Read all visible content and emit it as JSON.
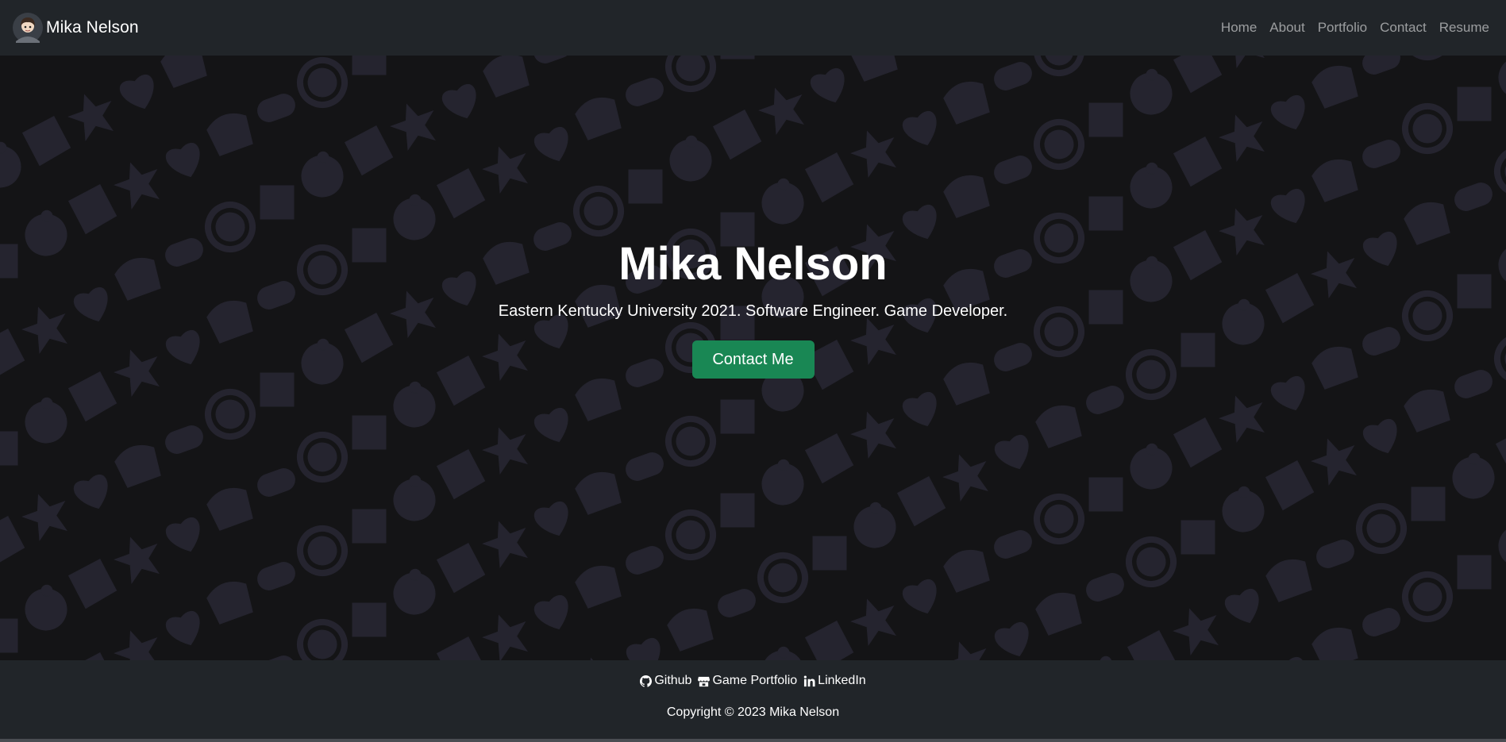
{
  "navbar": {
    "brand": "Mika Nelson",
    "links": [
      "Home",
      "About",
      "Portfolio",
      "Contact",
      "Resume"
    ]
  },
  "hero": {
    "title": "Mika Nelson",
    "subtitle": "Eastern Kentucky University 2021. Software Engineer. Game Developer.",
    "cta_label": "Contact Me"
  },
  "footer": {
    "links": [
      {
        "label": "Github",
        "icon": "github-icon"
      },
      {
        "label": "Game Portfolio",
        "icon": "storefront-icon"
      },
      {
        "label": "LinkedIn",
        "icon": "linkedin-icon"
      }
    ],
    "copyright": "Copyright © 2023 Mika Nelson"
  },
  "colors": {
    "navbar_bg": "#212529",
    "hero_bg": "#141416",
    "pattern_icon": "#25242f",
    "cta_bg": "#198754"
  }
}
